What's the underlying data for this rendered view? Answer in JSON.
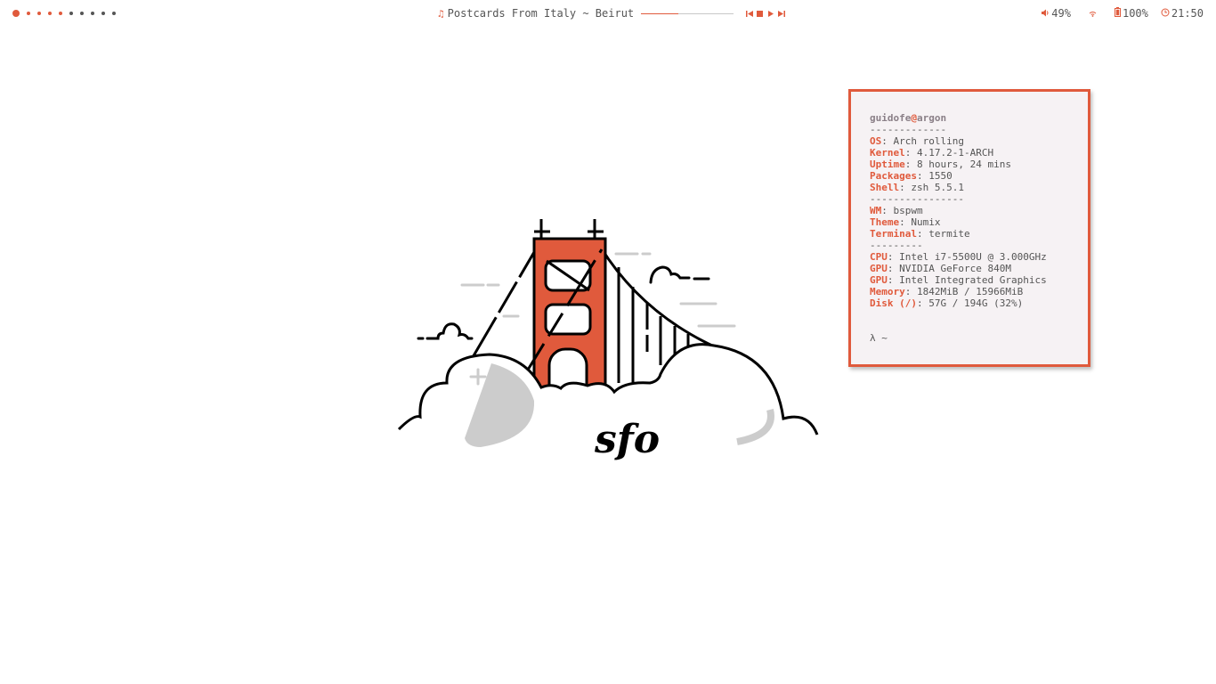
{
  "topbar": {
    "workspaces": [
      {
        "state": "active"
      },
      {
        "state": "occupied"
      },
      {
        "state": "occupied"
      },
      {
        "state": "occupied"
      },
      {
        "state": "occupied"
      },
      {
        "state": "empty"
      },
      {
        "state": "empty"
      },
      {
        "state": "empty"
      },
      {
        "state": "empty"
      },
      {
        "state": "empty"
      }
    ],
    "music": {
      "icon": "music-note-icon",
      "track": "Postcards From Italy ~ Beirut",
      "progress": 0.4,
      "controls": [
        "previous-icon",
        "stop-icon",
        "play-icon",
        "next-icon"
      ]
    },
    "volume": {
      "icon": "speaker-icon",
      "value": "49%"
    },
    "wifi": {
      "icon": "wifi-icon"
    },
    "battery": {
      "icon": "battery-icon",
      "value": "100%"
    },
    "clock": {
      "icon": "clock-icon",
      "value": "21:50"
    }
  },
  "colors": {
    "accent": "#e05a3c",
    "text": "#555555",
    "terminal_bg": "#f6f2f4",
    "muted": "#8a7f87"
  },
  "terminal": {
    "user": "guidofe",
    "at": "@",
    "host": "argon",
    "sep1": "-------------",
    "info1": [
      {
        "key": "OS",
        "value": "Arch rolling"
      },
      {
        "key": "Kernel",
        "value": "4.17.2-1-ARCH"
      },
      {
        "key": "Uptime",
        "value": "8 hours, 24 mins"
      },
      {
        "key": "Packages",
        "value": "1550"
      },
      {
        "key": "Shell",
        "value": "zsh 5.5.1"
      }
    ],
    "sep2": "----------------",
    "info2": [
      {
        "key": "WM",
        "value": "bspwm"
      },
      {
        "key": "Theme",
        "value": "Numix"
      },
      {
        "key": "Terminal",
        "value": "termite"
      }
    ],
    "sep3": "---------",
    "info3": [
      {
        "key": "CPU",
        "value": "Intel i7-5500U @ 3.000GHz"
      },
      {
        "key": "GPU",
        "value": "NVIDIA GeForce 840M"
      },
      {
        "key": "GPU",
        "value": "Intel Integrated Graphics"
      },
      {
        "key": "Memory",
        "value": "1842MiB / 15966MiB"
      },
      {
        "key": "Disk (/)",
        "value": "57G / 194G (32%)"
      }
    ],
    "colon": ": ",
    "prompt": "λ ~"
  },
  "wallpaper": {
    "text": "sfo"
  }
}
